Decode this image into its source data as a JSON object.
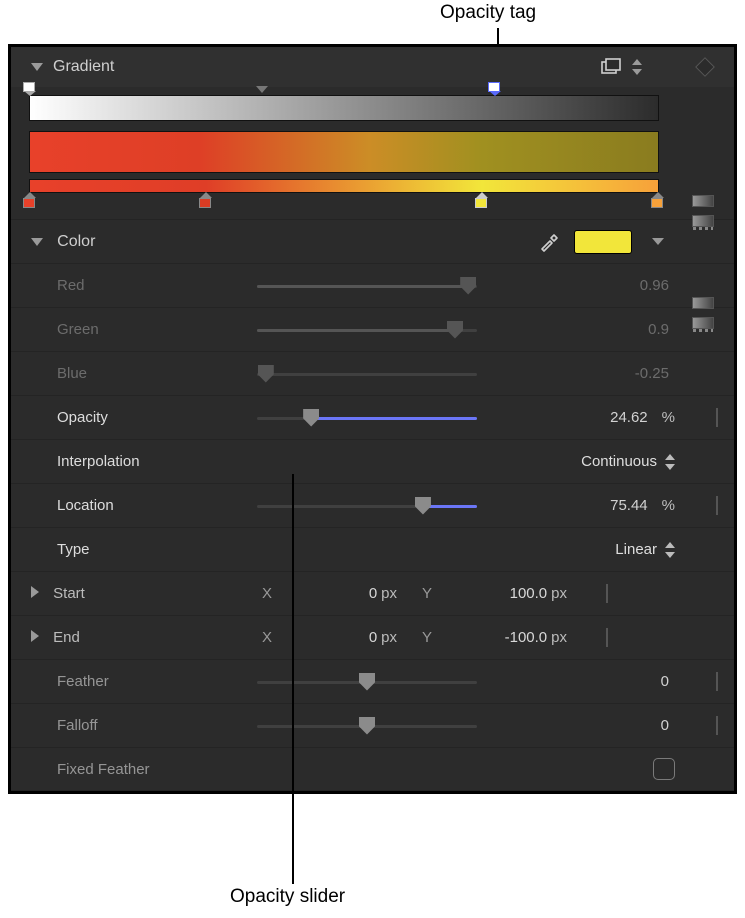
{
  "annotations": {
    "top": "Opacity tag",
    "bottom": "Opacity slider"
  },
  "section": {
    "title": "Gradient"
  },
  "color_section": {
    "title": "Color",
    "swatch_hex": "#f2e63a"
  },
  "sliders": {
    "red": {
      "label": "Red",
      "value": "0.96",
      "fill_pct": 96,
      "thumb_pct": 96
    },
    "green": {
      "label": "Green",
      "value": "0.9",
      "fill_pct": 90,
      "thumb_pct": 90
    },
    "blue": {
      "label": "Blue",
      "value": "-0.25",
      "fill_pct": 0,
      "thumb_pct": 4
    },
    "opacity": {
      "label": "Opacity",
      "value": "24.62",
      "unit": "%",
      "thumb_pct": 24.62,
      "fill_from": 24.62,
      "fill_to": 100
    },
    "location": {
      "label": "Location",
      "value": "75.44",
      "unit": "%",
      "thumb_pct": 75.44,
      "fill_from": 75.44,
      "fill_to": 100
    },
    "feather": {
      "label": "Feather",
      "value": "0",
      "thumb_pct": 50
    },
    "falloff": {
      "label": "Falloff",
      "value": "0",
      "thumb_pct": 50
    }
  },
  "interpolation": {
    "label": "Interpolation",
    "value": "Continuous"
  },
  "type": {
    "label": "Type",
    "value": "Linear"
  },
  "start": {
    "label": "Start",
    "x": "0",
    "y": "100.0",
    "unit": "px"
  },
  "end": {
    "label": "End",
    "x": "0",
    "y": "-100.0",
    "unit": "px"
  },
  "fixed_feather": {
    "label": "Fixed Feather"
  },
  "opacity_tags": [
    {
      "pos_pct": 0,
      "selected": false
    },
    {
      "pos_pct": 74,
      "selected": true
    }
  ],
  "opacity_mid_pct": 37,
  "color_tags": [
    {
      "pos_pct": 0,
      "hex": "#e8412a",
      "selected": false
    },
    {
      "pos_pct": 28,
      "hex": "#da3c24",
      "selected": false
    },
    {
      "pos_pct": 72,
      "hex": "#f2e63a",
      "selected": true
    },
    {
      "pos_pct": 100,
      "hex": "#f7a13a",
      "selected": false
    }
  ]
}
